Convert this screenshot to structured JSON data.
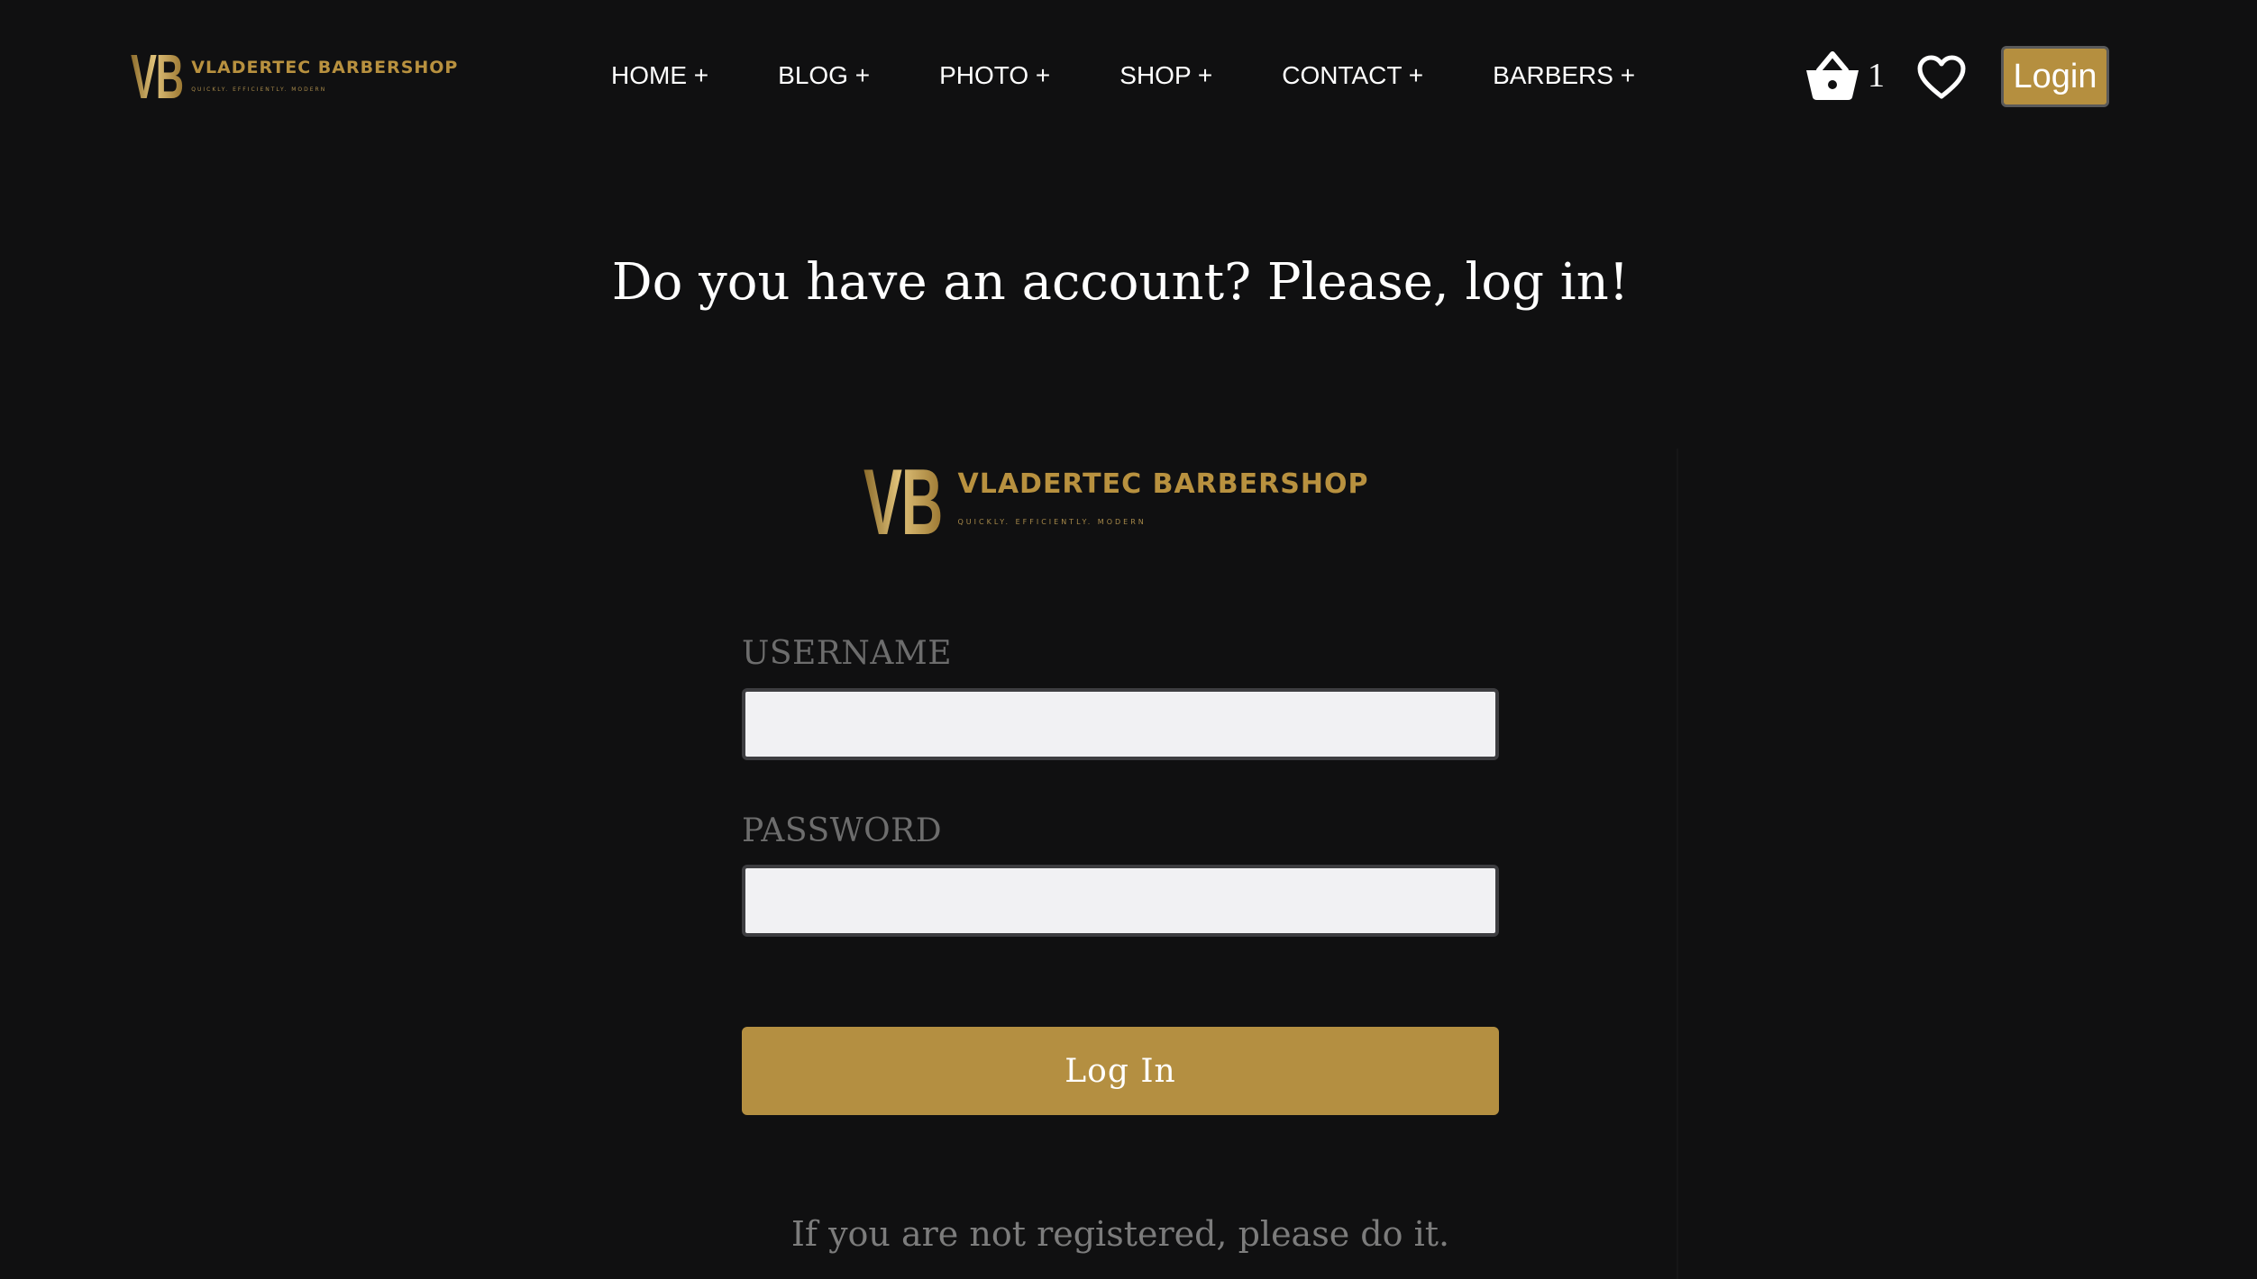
{
  "brand": {
    "mark": "VB",
    "name": "VLADERTEC BARBERSHOP",
    "tagline": "QUICKLY. EFFICIENTLY. MODERN",
    "accent_color": "#b58f3f",
    "background_color": "#101011"
  },
  "nav": {
    "items": [
      {
        "label": "HOME +"
      },
      {
        "label": "BLOG +"
      },
      {
        "label": "PHOTO +"
      },
      {
        "label": "SHOP +"
      },
      {
        "label": "CONTACT +"
      },
      {
        "label": "BARBERS +"
      }
    ]
  },
  "header_actions": {
    "cart_icon": "basket-icon",
    "cart_count": "1",
    "wishlist_icon": "heart-icon",
    "login_label": "Login"
  },
  "main": {
    "title": "Do you have an account? Please, log in!",
    "form": {
      "username_label": "USERNAME",
      "username_value": "",
      "password_label": "PASSWORD",
      "password_value": "",
      "submit_label": "Log In"
    },
    "register_note": "If you are not registered, please do it."
  }
}
